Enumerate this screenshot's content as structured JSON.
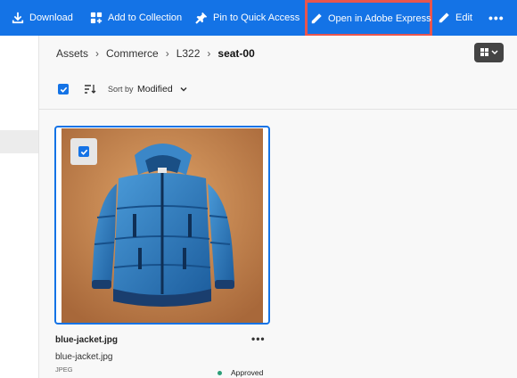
{
  "actionbar": {
    "download": "Download",
    "add_to_collection": "Add to Collection",
    "pin": "Pin to Quick Access",
    "open_express": "Open in Adobe Express",
    "edit": "Edit",
    "more": "•••"
  },
  "breadcrumb": {
    "items": [
      "Assets",
      "Commerce",
      "L322"
    ],
    "current": "seat-00"
  },
  "toolbar": {
    "sort_label": "Sort by",
    "sort_value": "Modified",
    "select_all_checked": true
  },
  "card": {
    "title": "blue-jacket.jpg",
    "filename": "blue-jacket.jpg",
    "type": "JPEG",
    "status": "Approved",
    "more": "•••",
    "selected": true
  },
  "colors": {
    "accent": "#1473e6",
    "highlight": "#e8554e",
    "status_approved": "#2d9d78"
  }
}
